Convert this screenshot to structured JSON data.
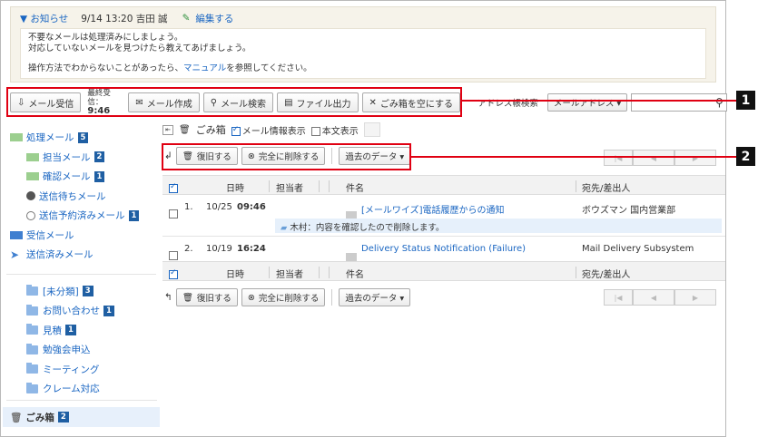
{
  "notice": {
    "toggle": "▼ お知らせ",
    "meta": "9/14 13:20 吉田 誠",
    "edit": "編集する",
    "line1": "不要なメールは処理済みにしましょう。",
    "line2": "対応していないメールを見つけたら教えてあげましょう。",
    "line3_pre": "操作方法でわからないことがあったら、",
    "line3_link": "マニュアル",
    "line3_post": "を参照してください。"
  },
  "toolbar": {
    "receive": "メール受信",
    "last_label": "最終受信：",
    "last_time": "9:46",
    "compose": "メール作成",
    "search": "メール検索",
    "export": "ファイル出力",
    "empty_trash": "ごみ箱を空にする",
    "address_search": "アドレス帳検索",
    "address_select": "メールアドレス ▾",
    "search_input_value": ""
  },
  "options": {
    "folder_title": "ごみ箱",
    "show_mail_info": "メール情報表示",
    "show_body": "本文表示"
  },
  "actions": {
    "restore": "復旧する",
    "delete_permanently": "完全に削除する",
    "past_data": "過去のデータ ▾"
  },
  "pager": {
    "first": "|◀",
    "prev": "◀",
    "next": "▶"
  },
  "columns": {
    "date": "日時",
    "assignee": "担当者",
    "subject": "件名",
    "recipient": "宛先/差出人"
  },
  "rows": [
    {
      "num": "1.",
      "date": "10/25",
      "time": "09:46",
      "subject": "[メールワイズ]電話履歴からの通知",
      "recipient": "ボウズマン 国内営業部",
      "memo": "木村：内容を確認したので削除します。"
    },
    {
      "num": "2.",
      "date": "10/19",
      "time": "16:24",
      "subject": "Delivery Status Notification (Failure)",
      "recipient": "Mail Delivery Subsystem"
    }
  ],
  "sidebar": {
    "processing": {
      "label": "処理メール",
      "count": "5"
    },
    "assigned": {
      "label": "担当メール",
      "count": "2"
    },
    "confirm": {
      "label": "確認メール",
      "count": "1"
    },
    "waiting": {
      "label": "送信待ちメール"
    },
    "scheduled": {
      "label": "送信予約済みメール",
      "count": "1"
    },
    "received": {
      "label": "受信メール"
    },
    "sent": {
      "label": "送信済みメール"
    },
    "folders": [
      {
        "label": "[未分類]",
        "count": "3"
      },
      {
        "label": "お問い合わせ",
        "count": "1"
      },
      {
        "label": "見積",
        "count": "1"
      },
      {
        "label": "勉強会申込"
      },
      {
        "label": "ミーティング"
      },
      {
        "label": "クレーム対応"
      }
    ],
    "trash": {
      "label": "ごみ箱",
      "count": "2"
    }
  },
  "callouts": {
    "one": "1",
    "two": "2"
  },
  "colors": {
    "accent": "#1a66c2",
    "badge": "#1f5fa3",
    "callout_border": "#e00012"
  }
}
